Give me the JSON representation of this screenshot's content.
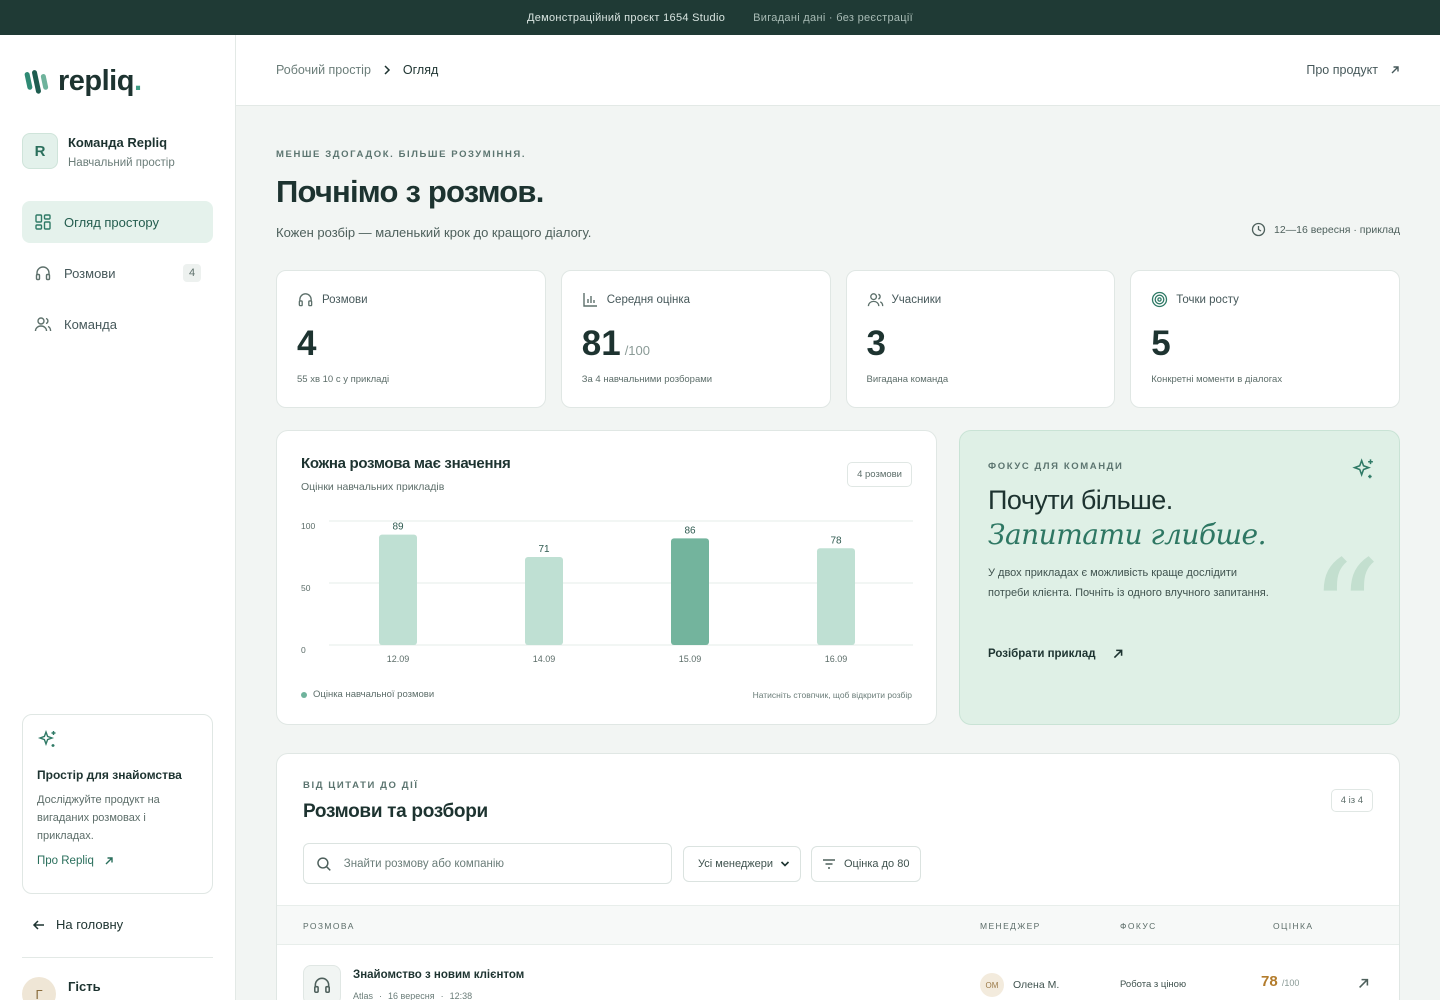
{
  "banner": {
    "project": "Демонстраційний проєкт 1654 Studio",
    "note": "Вигадані дані · без реєстрації"
  },
  "sidebar": {
    "logo": "repliq",
    "logo_dot": ".",
    "team": {
      "initial": "R",
      "name": "Команда Repliq",
      "subtitle": "Навчальний простір"
    },
    "nav": [
      {
        "label": "Огляд простору",
        "icon": "dashboard-icon",
        "active": true
      },
      {
        "label": "Розмови",
        "icon": "headphones-icon",
        "badge": "4"
      },
      {
        "label": "Команда",
        "icon": "users-icon"
      }
    ],
    "promo": {
      "title": "Простір для знайомства",
      "text": "Досліджуйте продукт на вигаданих розмовах і прикладах.",
      "link": "Про Repliq"
    },
    "back": "На головну",
    "user": {
      "initial": "Г",
      "name": "Гість"
    }
  },
  "header": {
    "crumb_root": "Робочий простір",
    "crumb_current": "Огляд",
    "about": "Про продукт"
  },
  "hero": {
    "eyebrow": "МЕНШЕ ЗДОГАДОК. БІЛЬШЕ РОЗУМІННЯ.",
    "title": "Почнімо з розмов.",
    "subtitle": "Кожен розбір — маленький крок до кращого діалогу.",
    "date": "12—16 вересня · приклад"
  },
  "stats": [
    {
      "label": "Розмови",
      "value": "4",
      "unit": "",
      "note": "55 хв 10 с у прикладі"
    },
    {
      "label": "Середня оцінка",
      "value": "81",
      "unit": "/100",
      "note": "За 4 навчальними розборами"
    },
    {
      "label": "Учасники",
      "value": "3",
      "unit": "",
      "note": "Вигадана команда"
    },
    {
      "label": "Точки росту",
      "value": "5",
      "unit": "",
      "note": "Конкретні моменти в діалогах"
    }
  ],
  "chart_card": {
    "title": "Кожна розмова має значення",
    "subtitle": "Оцінки навчальних прикладів",
    "badge": "4 розмови",
    "legend": "Оцінка навчальної розмови",
    "hint": "Натисніть стовпчик, щоб відкрити розбір"
  },
  "chart_data": {
    "type": "bar",
    "categories": [
      "12.09",
      "14.09",
      "15.09",
      "16.09"
    ],
    "values": [
      89,
      71,
      86,
      78
    ],
    "highlight_index": 2,
    "ylim": [
      0,
      100
    ],
    "yticks": [
      "100",
      "50",
      "0"
    ],
    "grid": true,
    "colors": {
      "bar": "#bfe0d3",
      "highlight": "#73b49d",
      "grid": "#e6ecea"
    }
  },
  "focus": {
    "eyebrow": "ФОКУС ДЛЯ КОМАНДИ",
    "title1": "Почути більше.",
    "title2": "Запитати глибше.",
    "text": "У двох прикладах є можливість краще дослідити потреби клієнта. Почніть із одного влучного запитання.",
    "link": "Розібрати приклад"
  },
  "list": {
    "eyebrow": "ВІД ЦИТАТИ ДО ДІЇ",
    "title": "Розмови та розбори",
    "count": "4 із 4",
    "search_placeholder": "Знайти розмову або компанію",
    "manager_select": "Усі менеджери",
    "score_filter": "Оцінка до 80",
    "columns": [
      "РОЗМОВА",
      "МЕНЕДЖЕР",
      "ФОКУС",
      "ОЦІНКА"
    ],
    "rows": [
      {
        "title": "Знайомство з новим клієнтом",
        "company": "Atlas",
        "date": "16 вересня",
        "time": "12:38",
        "manager_initials": "ОМ",
        "manager": "Олена М.",
        "focus": "Робота з ціною",
        "score": "78",
        "score_max": "/100"
      }
    ]
  }
}
